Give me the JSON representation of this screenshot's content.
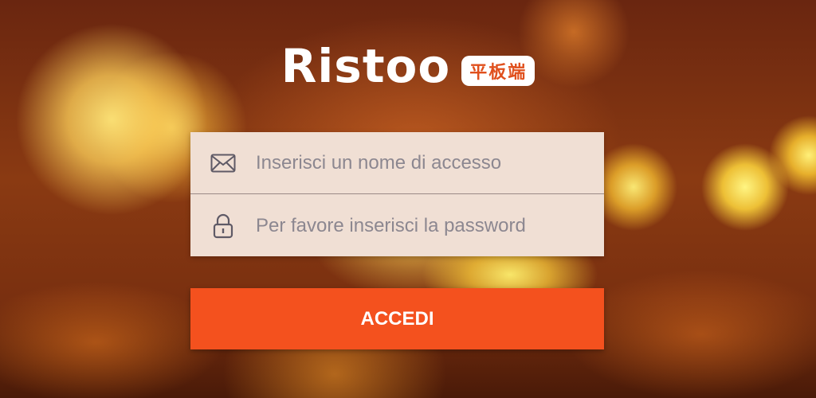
{
  "brand": {
    "name": "Ristoo",
    "badge": "平板端"
  },
  "login": {
    "username": {
      "placeholder": "Inserisci un nome di accesso",
      "icon": "envelope-icon"
    },
    "password": {
      "placeholder": "Per favore inserisci la password",
      "icon": "lock-icon"
    },
    "submit_label": "ACCEDI"
  },
  "colors": {
    "accent": "#f4511e",
    "card": "#f0dfd4",
    "badge_text": "#e0501d"
  }
}
